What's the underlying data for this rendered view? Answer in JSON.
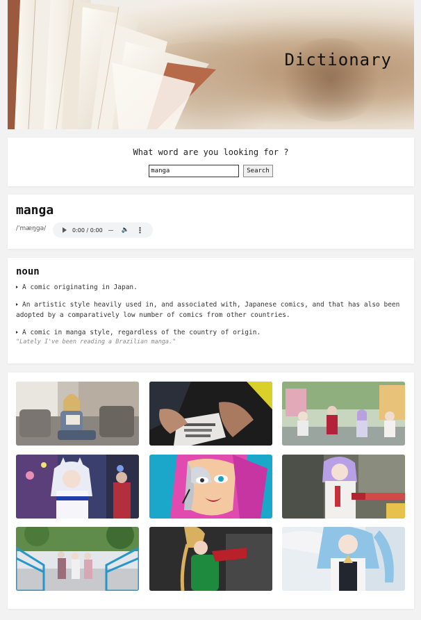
{
  "hero": {
    "title": "Dictionary",
    "image": "open-book-photo"
  },
  "search": {
    "prompt": "What word are you looking for ?",
    "value": "manga",
    "button_label": "Search"
  },
  "word": {
    "title": "manga",
    "phonetic": "/ˈmæŋɡə/",
    "audio": {
      "time": "0:00 / 0:00",
      "play_icon": "play-icon",
      "volume_icon": "volume-icon",
      "more_icon": "more-vert-icon"
    }
  },
  "meaning": {
    "part_of_speech": "noun",
    "definitions": [
      "A comic originating in Japan.",
      "An artistic style heavily used in, and associated with, Japanese comics, and that has also been adopted by a comparatively low number of comics from other countries.",
      "A comic in manga style, regardless of the country of origin."
    ],
    "example": "\"Lately I've been reading a Brazilian manga.\""
  },
  "gallery": {
    "images": [
      "woman-reading-manga-on-couch",
      "hands-holding-manga-book",
      "cosplayers-group-outdoor",
      "cosplayer-white-costume-crowd",
      "street-art-graffiti-face",
      "cosplayer-purple-hair",
      "cosplayers-on-blue-bridge",
      "cosplayer-green-outfit",
      "cosplayer-blue-hair-white-costume"
    ]
  },
  "colors": {
    "background": "#f2f2f2",
    "card": "#ffffff",
    "text": "#1a1a1a",
    "muted": "#888888"
  }
}
